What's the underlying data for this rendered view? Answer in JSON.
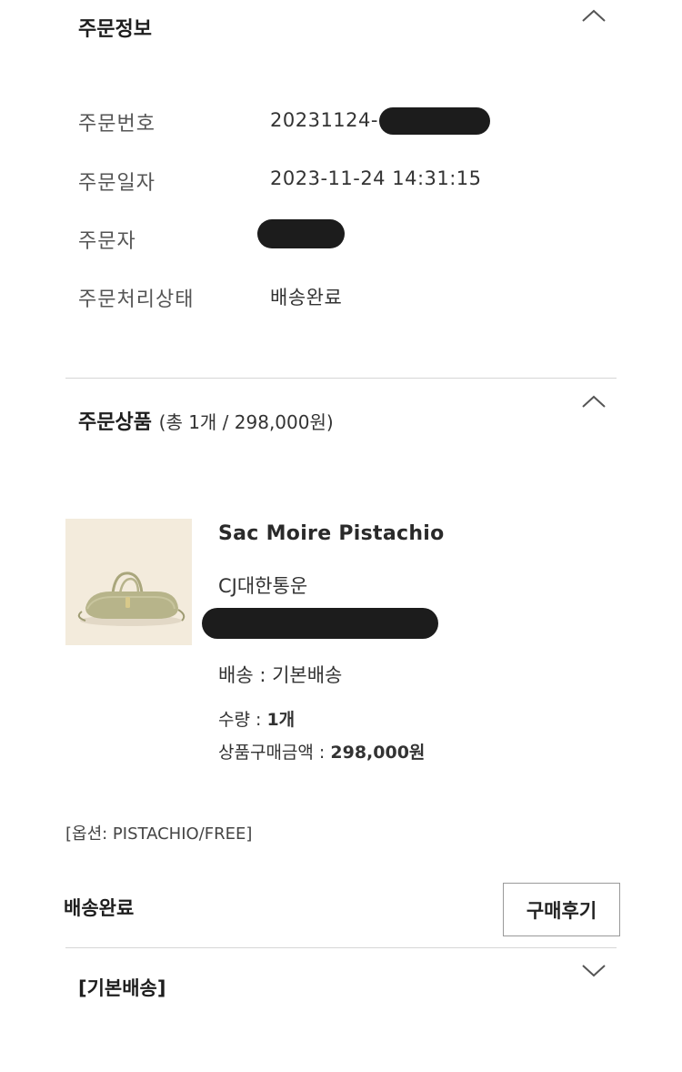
{
  "order_info": {
    "title": "주문정보",
    "collapse_icon": "chevron-up-icon",
    "rows": [
      {
        "label": "주문번호",
        "value": "20231124-"
      },
      {
        "label": "주문일자",
        "value": "2023-11-24 14:31:15"
      },
      {
        "label": "주문자",
        "value": ""
      },
      {
        "label": "주문처리상태",
        "value": "배송완료"
      }
    ]
  },
  "order_products": {
    "title": "주문상품",
    "summary": "(총 1개 / 298,000원)",
    "collapse_icon": "chevron-up-icon",
    "item": {
      "name": "Sac Moire Pistachio",
      "carrier": "CJ대한통운",
      "shipping": "배송 : 기본배송",
      "qty_label": "수량 : ",
      "qty_value": "1개",
      "price_label": "상품구매금액 : ",
      "price_value": "298,000원",
      "option": "[옵션: PISTACHIO/FREE]",
      "thumbnail_colors": {
        "background": "#f3ebdc",
        "bag": "#b7b48a"
      }
    }
  },
  "status": {
    "label": "배송완료",
    "review_button": "구매후기"
  },
  "delivery_group": {
    "title": "[기본배송]",
    "expand_icon": "chevron-down-icon"
  },
  "colors": {
    "divider": "#d6d6d6",
    "redaction": "#1c1c1c"
  }
}
